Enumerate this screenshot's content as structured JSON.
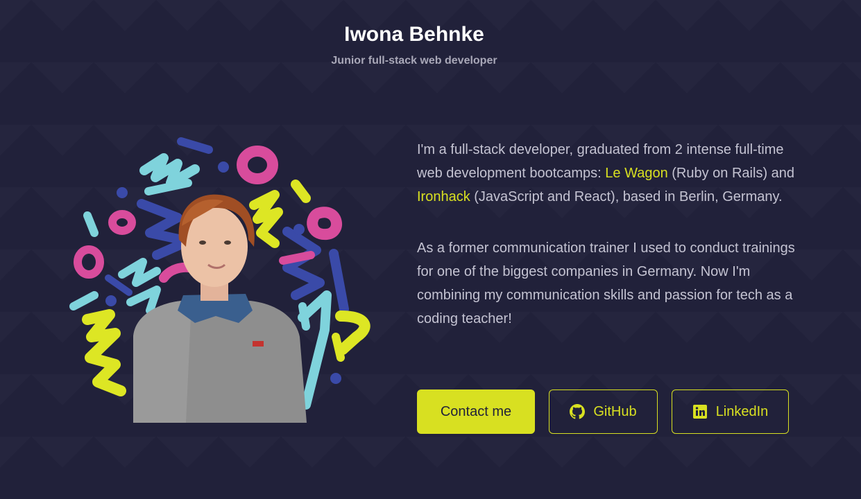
{
  "header": {
    "name": "Iwona Behnke",
    "role": "Junior full-stack web developer"
  },
  "about": {
    "p1_before": "I'm a full-stack developer, graduated from 2 intense full-time web development bootcamps: ",
    "p1_link1": "Le Wagon",
    "p1_middle": " (Ruby on Rails) and ",
    "p1_link2": "Ironhack",
    "p1_after": " (JavaScript and React), based in Berlin, Germany.",
    "p2": "As a former communication trainer I used to conduct trainings for one of the biggest companies in Germany. Now I'm combining my communication skills and passion for tech as a coding teacher!"
  },
  "buttons": {
    "contact": "Contact me",
    "github": "GitHub",
    "linkedin": "LinkedIn"
  },
  "icons": {
    "github": "github-icon",
    "linkedin": "linkedin-icon"
  },
  "colors": {
    "background": "#21213a",
    "accent": "#d8e021",
    "text": "#c4c3d2",
    "heading": "#ffffff",
    "doodle_pink": "#d84c9c",
    "doodle_cyan": "#7fd3dc",
    "doodle_blue": "#3a4aa8",
    "doodle_yellow": "#dde624"
  }
}
